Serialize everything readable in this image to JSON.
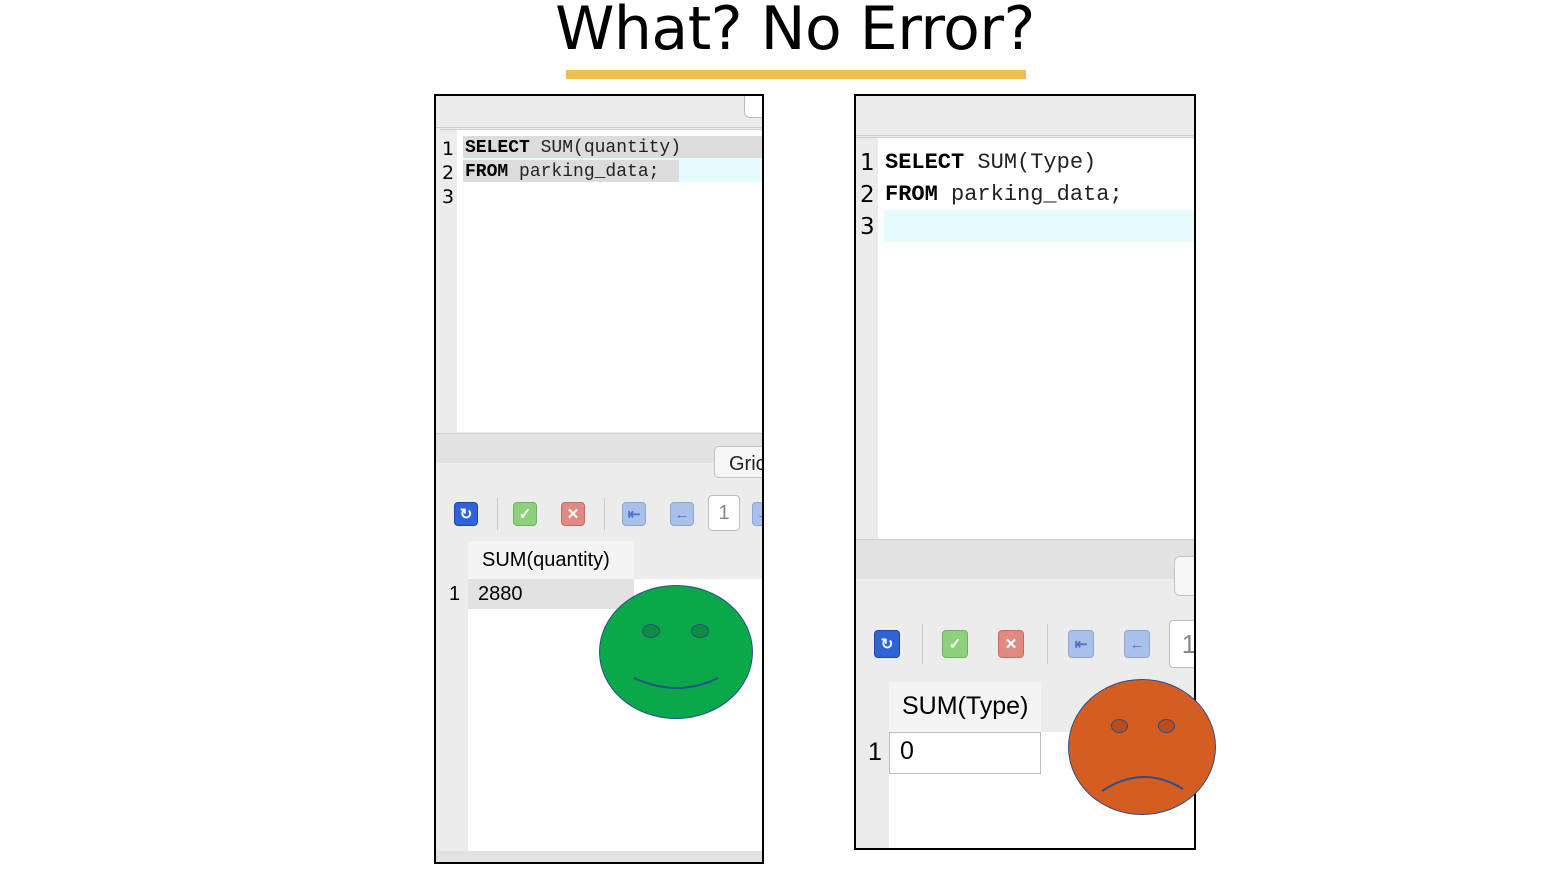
{
  "slide": {
    "title": "What? No Error?"
  },
  "left_panel": {
    "line_numbers": [
      "1",
      "2",
      "3"
    ],
    "code": [
      {
        "keyword": "SELECT",
        "rest": " SUM(quantity)"
      },
      {
        "keyword": "FROM",
        "rest": " parking_data;"
      }
    ],
    "tab_label": "Gric",
    "page_number": "1",
    "result_header": "SUM(quantity)",
    "result_row_number": "1",
    "result_value": "2880",
    "face": {
      "mood": "happy",
      "color": "#0ba84a"
    }
  },
  "right_panel": {
    "line_numbers": [
      "1",
      "2",
      "3"
    ],
    "code": [
      {
        "keyword": "SELECT",
        "rest": " SUM(Type)"
      },
      {
        "keyword": "FROM",
        "rest": " parking_data;"
      }
    ],
    "page_number": "1",
    "result_header": "SUM(Type)",
    "result_row_number": "1",
    "result_value": "0",
    "face": {
      "mood": "sad",
      "color": "#d45d22"
    }
  },
  "icons": {
    "refresh": "refresh-icon",
    "apply": "checkmark-icon",
    "cancel": "cancel-icon",
    "first": "first-page-icon",
    "previous": "previous-page-icon"
  }
}
